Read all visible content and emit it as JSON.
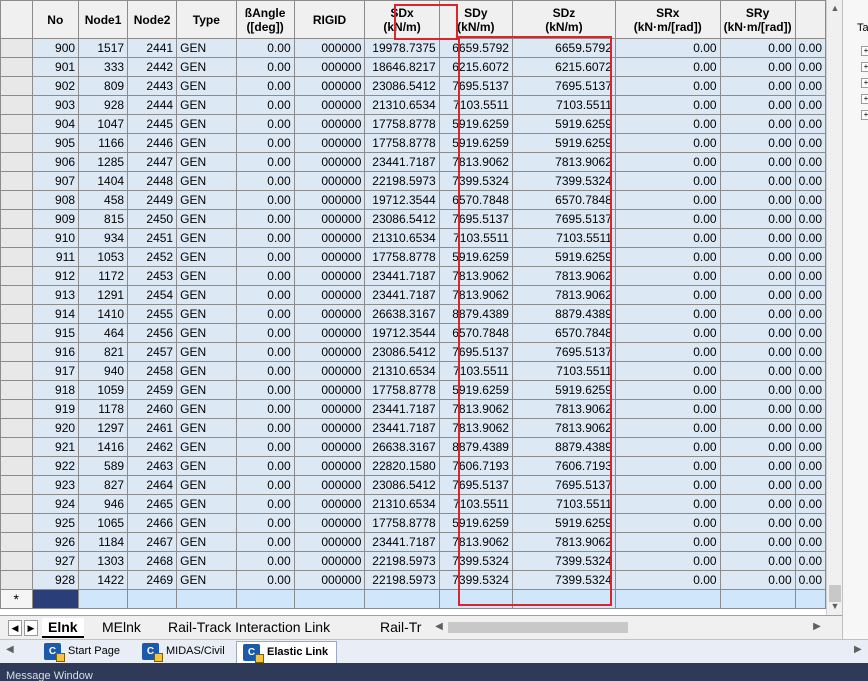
{
  "columns": [
    {
      "key": "no",
      "label1": "No",
      "label2": ""
    },
    {
      "key": "node1",
      "label1": "Node1",
      "label2": ""
    },
    {
      "key": "node2",
      "label1": "Node2",
      "label2": ""
    },
    {
      "key": "type",
      "label1": "Type",
      "label2": ""
    },
    {
      "key": "angle",
      "label1": "ßAngle",
      "label2": "([deg])"
    },
    {
      "key": "rigid",
      "label1": "RIGID",
      "label2": ""
    },
    {
      "key": "sdx",
      "label1": "SDx",
      "label2": "(kN/m)"
    },
    {
      "key": "sdy",
      "label1": "SDy",
      "label2": "(kN/m)"
    },
    {
      "key": "sdz",
      "label1": "SDz",
      "label2": "(kN/m)"
    },
    {
      "key": "srx",
      "label1": "SRx",
      "label2": "(kN·m/[rad])"
    },
    {
      "key": "sry",
      "label1": "SRy",
      "label2": "(kN·m/[rad])"
    }
  ],
  "rows": [
    [
      "900",
      "1517",
      "2441",
      "GEN",
      "0.00",
      "000000",
      "19978.7375",
      "6659.5792",
      "6659.5792",
      "0.00",
      "0.00"
    ],
    [
      "901",
      "333",
      "2442",
      "GEN",
      "0.00",
      "000000",
      "18646.8217",
      "6215.6072",
      "6215.6072",
      "0.00",
      "0.00"
    ],
    [
      "902",
      "809",
      "2443",
      "GEN",
      "0.00",
      "000000",
      "23086.5412",
      "7695.5137",
      "7695.5137",
      "0.00",
      "0.00"
    ],
    [
      "903",
      "928",
      "2444",
      "GEN",
      "0.00",
      "000000",
      "21310.6534",
      "7103.5511",
      "7103.5511",
      "0.00",
      "0.00"
    ],
    [
      "904",
      "1047",
      "2445",
      "GEN",
      "0.00",
      "000000",
      "17758.8778",
      "5919.6259",
      "5919.6259",
      "0.00",
      "0.00"
    ],
    [
      "905",
      "1166",
      "2446",
      "GEN",
      "0.00",
      "000000",
      "17758.8778",
      "5919.6259",
      "5919.6259",
      "0.00",
      "0.00"
    ],
    [
      "906",
      "1285",
      "2447",
      "GEN",
      "0.00",
      "000000",
      "23441.7187",
      "7813.9062",
      "7813.9062",
      "0.00",
      "0.00"
    ],
    [
      "907",
      "1404",
      "2448",
      "GEN",
      "0.00",
      "000000",
      "22198.5973",
      "7399.5324",
      "7399.5324",
      "0.00",
      "0.00"
    ],
    [
      "908",
      "458",
      "2449",
      "GEN",
      "0.00",
      "000000",
      "19712.3544",
      "6570.7848",
      "6570.7848",
      "0.00",
      "0.00"
    ],
    [
      "909",
      "815",
      "2450",
      "GEN",
      "0.00",
      "000000",
      "23086.5412",
      "7695.5137",
      "7695.5137",
      "0.00",
      "0.00"
    ],
    [
      "910",
      "934",
      "2451",
      "GEN",
      "0.00",
      "000000",
      "21310.6534",
      "7103.5511",
      "7103.5511",
      "0.00",
      "0.00"
    ],
    [
      "911",
      "1053",
      "2452",
      "GEN",
      "0.00",
      "000000",
      "17758.8778",
      "5919.6259",
      "5919.6259",
      "0.00",
      "0.00"
    ],
    [
      "912",
      "1172",
      "2453",
      "GEN",
      "0.00",
      "000000",
      "23441.7187",
      "7813.9062",
      "7813.9062",
      "0.00",
      "0.00"
    ],
    [
      "913",
      "1291",
      "2454",
      "GEN",
      "0.00",
      "000000",
      "23441.7187",
      "7813.9062",
      "7813.9062",
      "0.00",
      "0.00"
    ],
    [
      "914",
      "1410",
      "2455",
      "GEN",
      "0.00",
      "000000",
      "26638.3167",
      "8879.4389",
      "8879.4389",
      "0.00",
      "0.00"
    ],
    [
      "915",
      "464",
      "2456",
      "GEN",
      "0.00",
      "000000",
      "19712.3544",
      "6570.7848",
      "6570.7848",
      "0.00",
      "0.00"
    ],
    [
      "916",
      "821",
      "2457",
      "GEN",
      "0.00",
      "000000",
      "23086.5412",
      "7695.5137",
      "7695.5137",
      "0.00",
      "0.00"
    ],
    [
      "917",
      "940",
      "2458",
      "GEN",
      "0.00",
      "000000",
      "21310.6534",
      "7103.5511",
      "7103.5511",
      "0.00",
      "0.00"
    ],
    [
      "918",
      "1059",
      "2459",
      "GEN",
      "0.00",
      "000000",
      "17758.8778",
      "5919.6259",
      "5919.6259",
      "0.00",
      "0.00"
    ],
    [
      "919",
      "1178",
      "2460",
      "GEN",
      "0.00",
      "000000",
      "23441.7187",
      "7813.9062",
      "7813.9062",
      "0.00",
      "0.00"
    ],
    [
      "920",
      "1297",
      "2461",
      "GEN",
      "0.00",
      "000000",
      "23441.7187",
      "7813.9062",
      "7813.9062",
      "0.00",
      "0.00"
    ],
    [
      "921",
      "1416",
      "2462",
      "GEN",
      "0.00",
      "000000",
      "26638.3167",
      "8879.4389",
      "8879.4389",
      "0.00",
      "0.00"
    ],
    [
      "922",
      "589",
      "2463",
      "GEN",
      "0.00",
      "000000",
      "22820.1580",
      "7606.7193",
      "7606.7193",
      "0.00",
      "0.00"
    ],
    [
      "923",
      "827",
      "2464",
      "GEN",
      "0.00",
      "000000",
      "23086.5412",
      "7695.5137",
      "7695.5137",
      "0.00",
      "0.00"
    ],
    [
      "924",
      "946",
      "2465",
      "GEN",
      "0.00",
      "000000",
      "21310.6534",
      "7103.5511",
      "7103.5511",
      "0.00",
      "0.00"
    ],
    [
      "925",
      "1065",
      "2466",
      "GEN",
      "0.00",
      "000000",
      "17758.8778",
      "5919.6259",
      "5919.6259",
      "0.00",
      "0.00"
    ],
    [
      "926",
      "1184",
      "2467",
      "GEN",
      "0.00",
      "000000",
      "23441.7187",
      "7813.9062",
      "7813.9062",
      "0.00",
      "0.00"
    ],
    [
      "927",
      "1303",
      "2468",
      "GEN",
      "0.00",
      "000000",
      "22198.5973",
      "7399.5324",
      "7399.5324",
      "0.00",
      "0.00"
    ],
    [
      "928",
      "1422",
      "2469",
      "GEN",
      "0.00",
      "000000",
      "22198.5973",
      "7399.5324",
      "7399.5324",
      "0.00",
      "0.00"
    ]
  ],
  "new_row_marker": "*",
  "sheet_tabs": [
    "Elnk",
    "MElnk",
    "Rail-Track Interaction Link",
    "Rail-Tr"
  ],
  "active_sheet": "Elnk",
  "doc_tabs": [
    {
      "label": "Start Page",
      "icon": "civil-app-icon"
    },
    {
      "label": "MIDAS/Civil",
      "icon": "civil-app-icon"
    },
    {
      "label": "Elastic Link",
      "icon": "civil-app-icon"
    }
  ],
  "doc_tab_icon_letter": "C",
  "active_doc_tab": "Elastic Link",
  "right_pane": {
    "tab_label": "Ta"
  },
  "message_window_title": "Message Window",
  "colors": {
    "highlight_box": "#d9262c",
    "row_bg": "#dde8f5",
    "new_row_bg": "#cfe6fb"
  }
}
